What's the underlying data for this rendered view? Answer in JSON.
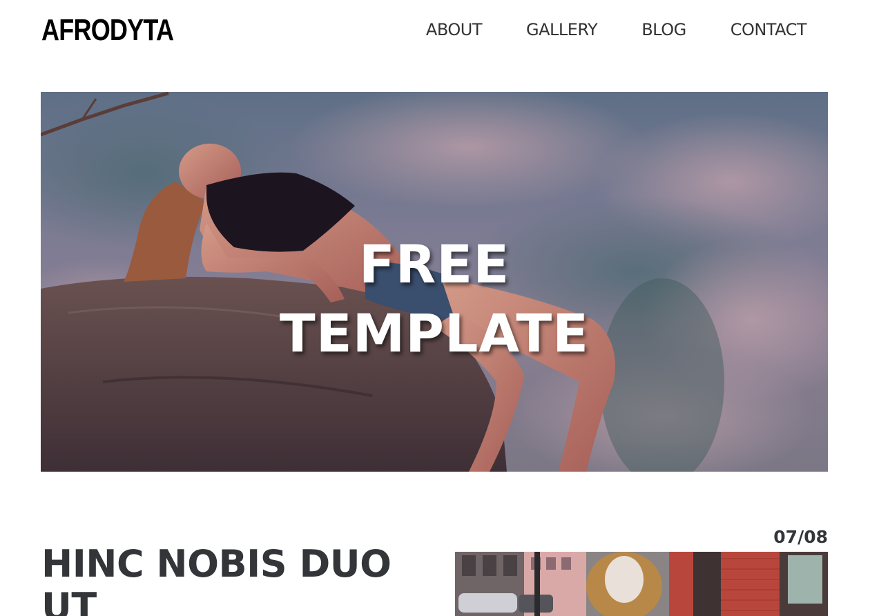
{
  "header": {
    "logo": "AFRODYTA",
    "nav": [
      "ABOUT",
      "GALLERY",
      "BLOG",
      "CONTACT"
    ]
  },
  "hero": {
    "title_line1": "FREE",
    "title_line2": "TEMPLATE"
  },
  "post": {
    "title": "HINC NOBIS DUO UT",
    "date": "07/08"
  }
}
